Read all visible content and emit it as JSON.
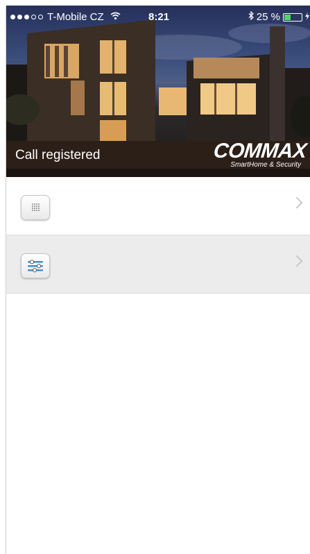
{
  "status_bar": {
    "carrier": "T-Mobile CZ",
    "time": "8:21",
    "battery_percent": "25 %",
    "battery_level": 0.25
  },
  "header": {
    "status_text": "Call registered",
    "brand_name": "COMMAX",
    "brand_tagline": "SmartHome & Security"
  },
  "menu": {
    "items": [
      {
        "icon": "speaker-icon",
        "active": false
      },
      {
        "icon": "settings-sliders-icon",
        "active": true
      }
    ]
  },
  "colors": {
    "battery_fill": "#4cd964",
    "active_row_bg": "#ececec",
    "chevron": "#c8c8cd"
  }
}
